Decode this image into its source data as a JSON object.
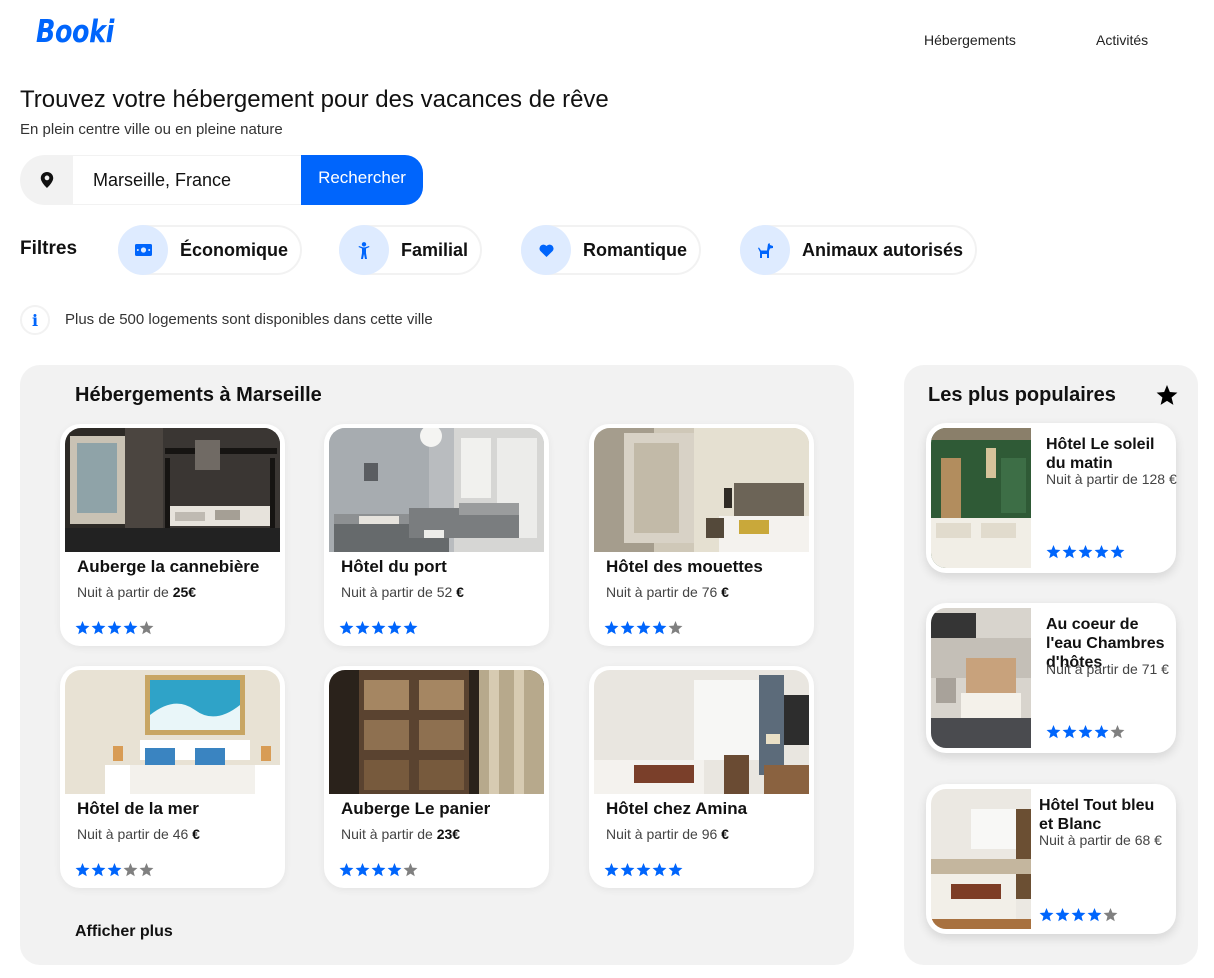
{
  "header": {
    "logo": "Booki",
    "nav": [
      "Hébergements",
      "Activités"
    ]
  },
  "hero": {
    "title": "Trouvez votre hébergement pour des vacances de rêve",
    "subtitle": "En plein centre ville ou en pleine nature"
  },
  "search": {
    "value": "Marseille, France",
    "button": "Rechercher"
  },
  "filters": {
    "label": "Filtres",
    "items": [
      {
        "label": "Économique",
        "icon": "money-icon"
      },
      {
        "label": "Familial",
        "icon": "child-icon"
      },
      {
        "label": "Romantique",
        "icon": "heart-icon"
      },
      {
        "label": "Animaux autorisés",
        "icon": "dog-icon"
      }
    ]
  },
  "info": {
    "icon_text": "i",
    "text": "Plus de 500 logements sont disponibles dans cette ville"
  },
  "accommodations": {
    "title": "Hébergements à Marseille",
    "more": "Afficher plus",
    "items": [
      {
        "name": "Auberge la cannebière",
        "price_prefix": "Nuit à partir de ",
        "price": "25€",
        "rating": 4
      },
      {
        "name": "Hôtel du port",
        "price_prefix": "Nuit à partir de 52  ",
        "price": "€",
        "rating": 5
      },
      {
        "name": "Hôtel des mouettes",
        "price_prefix": "Nuit à partir de 76 ",
        "price": "€",
        "rating": 4
      },
      {
        "name": "Hôtel de la mer",
        "price_prefix": "Nuit à partir de 46 ",
        "price": "€",
        "rating": 3
      },
      {
        "name": "Auberge Le panier",
        "price_prefix": "Nuit à partir de  ",
        "price": "23€",
        "rating": 4
      },
      {
        "name": "Hôtel chez Amina",
        "price_prefix": "Nuit à partir de 96 ",
        "price": "€",
        "rating": 5
      }
    ]
  },
  "popular": {
    "title": "Les plus populaires",
    "items": [
      {
        "name": "Hôtel Le soleil du matin",
        "price": "Nuit à partir de 128 €",
        "rating": 5
      },
      {
        "name": "Au coeur de l'eau Chambres d'hôtes",
        "price": "Nuit à partir de 71 €",
        "rating": 4
      },
      {
        "name": "Hôtel Tout bleu et Blanc",
        "price": "Nuit à partir de 68 €",
        "rating": 4
      }
    ]
  },
  "colors": {
    "accent": "#0065FC",
    "panel": "#F2F2F2",
    "filter_icon_bg": "#DEEBFF",
    "star_off": "#808080"
  }
}
